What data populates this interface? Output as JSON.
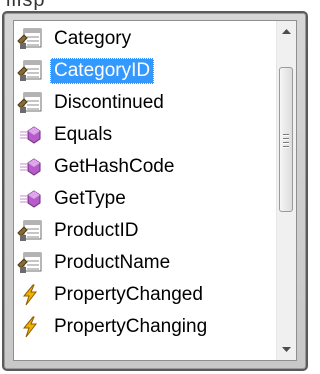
{
  "top_clip_text": "ilisp",
  "list": {
    "items": [
      {
        "label": "Category",
        "icon": "property-icon",
        "selected": false
      },
      {
        "label": "CategoryID",
        "icon": "property-icon",
        "selected": true
      },
      {
        "label": "Discontinued",
        "icon": "property-icon",
        "selected": false
      },
      {
        "label": "Equals",
        "icon": "method-icon",
        "selected": false
      },
      {
        "label": "GetHashCode",
        "icon": "method-icon",
        "selected": false
      },
      {
        "label": "GetType",
        "icon": "method-icon",
        "selected": false
      },
      {
        "label": "ProductID",
        "icon": "property-icon",
        "selected": false
      },
      {
        "label": "ProductName",
        "icon": "property-icon",
        "selected": false
      },
      {
        "label": "PropertyChanged",
        "icon": "event-icon",
        "selected": false
      },
      {
        "label": "PropertyChanging",
        "icon": "event-icon",
        "selected": false
      }
    ]
  },
  "colors": {
    "selection": "#3399ff",
    "method_icon": "#b65cc8",
    "event_icon": "#e8a000"
  }
}
